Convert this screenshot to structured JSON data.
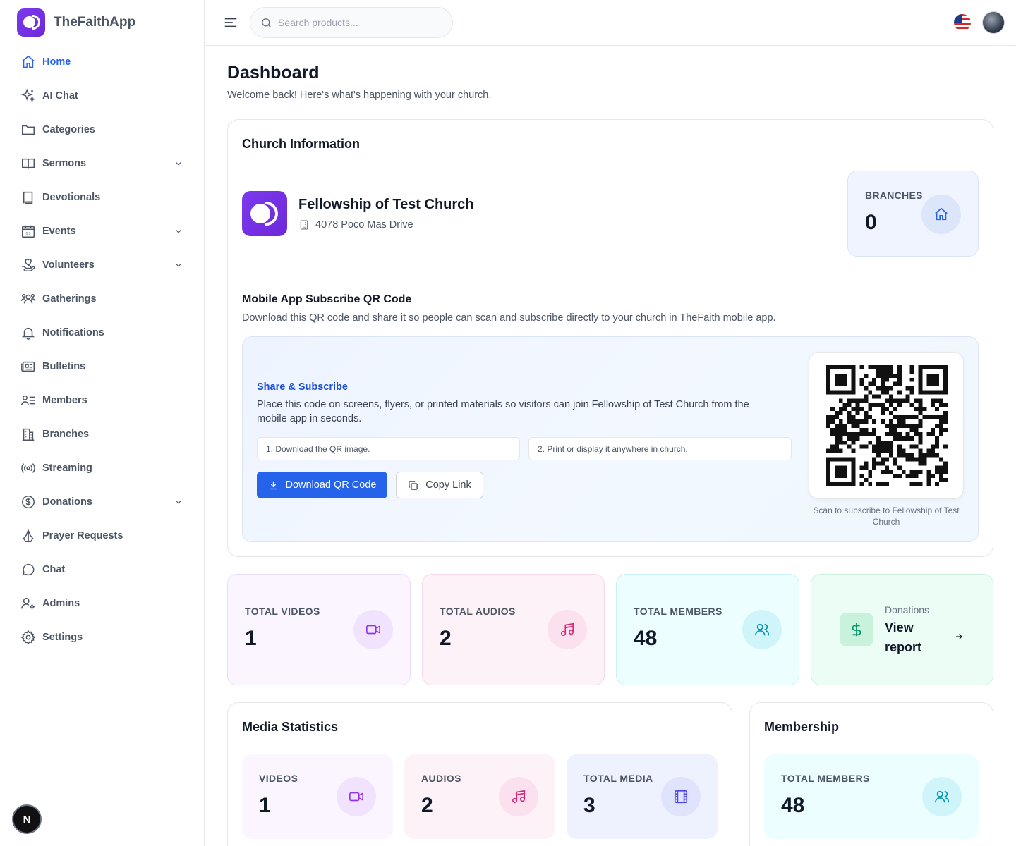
{
  "app": {
    "name": "TheFaithApp"
  },
  "search": {
    "placeholder": "Search products..."
  },
  "sidebar": {
    "items": [
      {
        "label": "Home",
        "icon": "home-icon",
        "active": true
      },
      {
        "label": "AI Chat",
        "icon": "sparkles-icon"
      },
      {
        "label": "Categories",
        "icon": "folder-icon"
      },
      {
        "label": "Sermons",
        "icon": "book-open-icon",
        "expandable": true
      },
      {
        "label": "Devotionals",
        "icon": "book-icon"
      },
      {
        "label": "Events",
        "icon": "calendar-icon",
        "expandable": true
      },
      {
        "label": "Volunteers",
        "icon": "hand-heart-icon",
        "expandable": true
      },
      {
        "label": "Gatherings",
        "icon": "users-group-icon"
      },
      {
        "label": "Notifications",
        "icon": "bell-icon"
      },
      {
        "label": "Bulletins",
        "icon": "newspaper-icon"
      },
      {
        "label": "Members",
        "icon": "user-list-icon"
      },
      {
        "label": "Branches",
        "icon": "building-icon"
      },
      {
        "label": "Streaming",
        "icon": "broadcast-icon"
      },
      {
        "label": "Donations",
        "icon": "dollar-circle-icon",
        "expandable": true
      },
      {
        "label": "Prayer Requests",
        "icon": "praying-hands-icon"
      },
      {
        "label": "Chat",
        "icon": "message-circle-icon"
      },
      {
        "label": "Admins",
        "icon": "user-cog-icon"
      },
      {
        "label": "Settings",
        "icon": "gear-icon"
      }
    ]
  },
  "dashboard": {
    "title": "Dashboard",
    "subtitle": "Welcome back! Here's what's happening with your church."
  },
  "church": {
    "section_title": "Church Information",
    "name": "Fellowship of Test Church",
    "address": "4078 Poco Mas Drive",
    "branches_label": "BRANCHES",
    "branches_value": "0"
  },
  "qr": {
    "title": "Mobile App Subscribe QR Code",
    "description": "Download this QR code and share it so people can scan and subscribe directly to your church in TheFaith mobile app.",
    "share_title": "Share & Subscribe",
    "share_text": "Place this code on screens, flyers, or printed materials so visitors can join Fellowship of Test Church from the mobile app in seconds.",
    "step1": "1. Download the QR image.",
    "step2": "2. Print or display it anywhere in church.",
    "download_label": "Download QR Code",
    "copy_label": "Copy Link",
    "caption": "Scan to subscribe to Fellowship of Test Church"
  },
  "stats": {
    "videos": {
      "label": "TOTAL VIDEOS",
      "value": "1"
    },
    "audios": {
      "label": "TOTAL AUDIOS",
      "value": "2"
    },
    "members": {
      "label": "TOTAL MEMBERS",
      "value": "48"
    },
    "donations": {
      "label": "Donations",
      "link": "View report"
    }
  },
  "media": {
    "title": "Media Statistics",
    "videos": {
      "label": "VIDEOS",
      "value": "1"
    },
    "audios": {
      "label": "AUDIOS",
      "value": "2"
    },
    "total": {
      "label": "TOTAL MEDIA",
      "value": "3"
    }
  },
  "membership": {
    "title": "Membership",
    "total": {
      "label": "TOTAL MEMBERS",
      "value": "48"
    }
  },
  "dev_badge": "N",
  "colors": {
    "primary": "#2563eb",
    "brand": "#7c3aed"
  }
}
